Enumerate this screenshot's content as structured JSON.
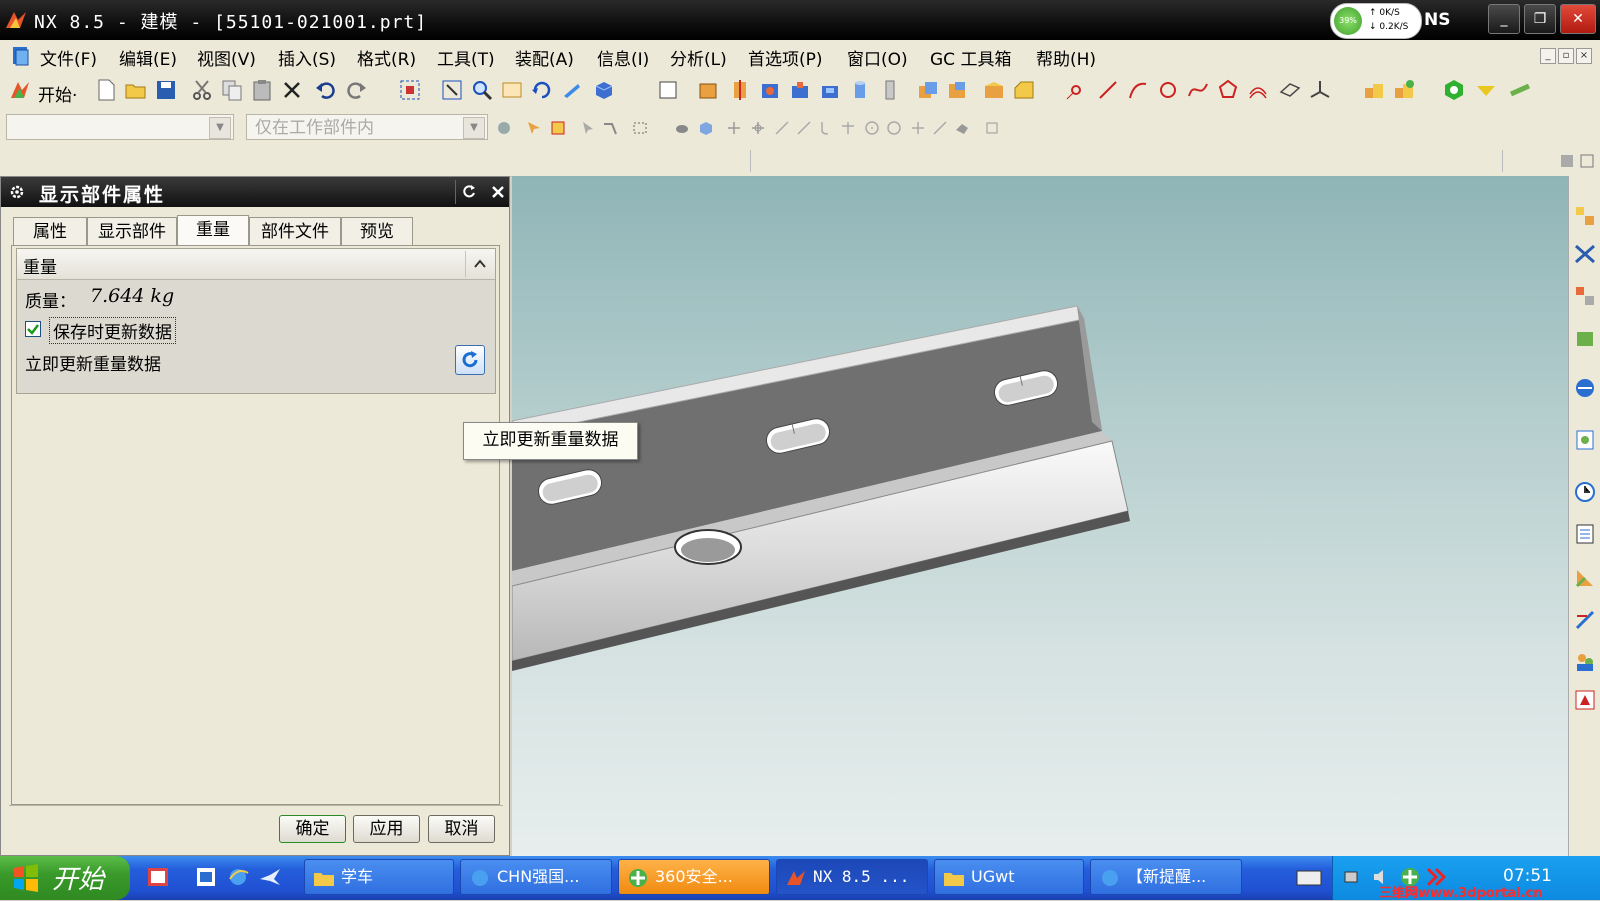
{
  "window": {
    "title": "NX 8.5 - 建模 - [55101-021001.prt]",
    "brand_fragment": "NS",
    "net_percent": "39%",
    "net_up": "0K/S",
    "net_down": "0.2K/S",
    "min_glyph": "_",
    "max_glyph": "❐",
    "close_glyph": "✕"
  },
  "menu": {
    "items": [
      "文件(F)",
      "编辑(E)",
      "视图(V)",
      "插入(S)",
      "格式(R)",
      "工具(T)",
      "装配(A)",
      "信息(I)",
      "分析(L)",
      "首选项(P)",
      "窗口(O)",
      "GC 工具箱",
      "帮助(H)"
    ]
  },
  "toolbar": {
    "start_label": "开始·",
    "filter_placeholder": "仅在工作部件内"
  },
  "dialog": {
    "title": "显示部件属性",
    "tabs": [
      "属性",
      "显示部件",
      "重量",
      "部件文件",
      "预览"
    ],
    "active_tab": "重量",
    "group_title": "重量",
    "mass_label": "质量：",
    "mass_value": "7.644 kg",
    "update_on_save_label": "保存时更新数据",
    "update_on_save_checked": true,
    "update_now_label": "立即更新重量数据",
    "ok_label": "确定",
    "apply_label": "应用",
    "cancel_label": "取消"
  },
  "tooltip": {
    "text": "立即更新重量数据"
  },
  "taskbar": {
    "start_label": "开始",
    "tasks": [
      "学车",
      "CHN强国...",
      "360安全...",
      "NX 8.5 ...",
      "UGwt",
      "【新提醒..."
    ],
    "clock": "07:51",
    "watermark": "三维网www.3dportal.cn"
  },
  "colors": {
    "title_bar": "#000000",
    "viewport_top": "#8fb5b7",
    "viewport_bottom": "#e7eeed",
    "taskbar": "#245edb",
    "start_button": "#3a9a2a"
  }
}
